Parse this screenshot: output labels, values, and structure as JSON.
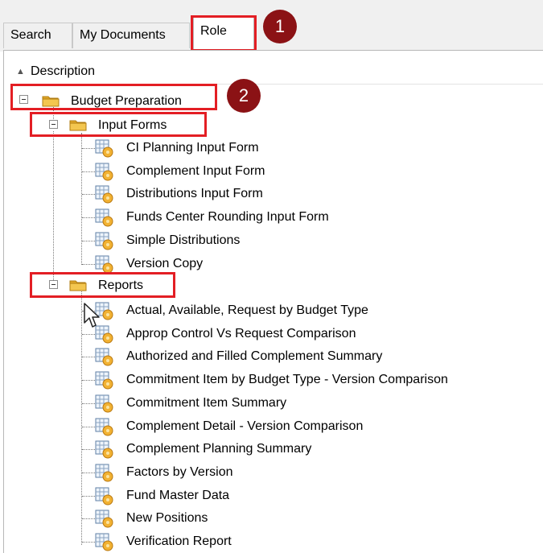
{
  "tabs": {
    "search": "Search",
    "my_documents": "My Documents",
    "role": "Role"
  },
  "callouts": [
    "1",
    "2"
  ],
  "column_header": "Description",
  "tree": {
    "root": "Budget Preparation",
    "input_forms": {
      "label": "Input Forms",
      "items": [
        "CI Planning Input Form",
        "Complement Input Form",
        "Distributions Input Form",
        "Funds Center Rounding Input Form",
        "Simple Distributions",
        "Version Copy"
      ]
    },
    "reports": {
      "label": "Reports",
      "items": [
        "Actual, Available, Request by Budget Type",
        "Approp Control Vs Request Comparison",
        "Authorized and Filled Complement Summary",
        "Commitment Item by Budget Type - Version Comparison",
        "Commitment Item Summary",
        "Complement Detail - Version Comparison",
        "Complement Planning Summary",
        "Factors by Version",
        "Fund Master Data",
        "New Positions",
        "Verification Report"
      ]
    }
  },
  "colors": {
    "highlight": "#e31e24",
    "badge": "#8b1215",
    "folder": "#f3c64f"
  }
}
